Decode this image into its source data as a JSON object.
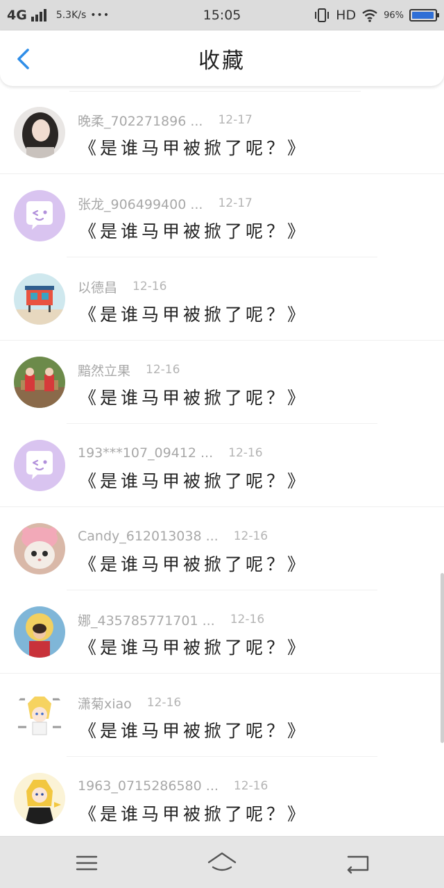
{
  "status_bar": {
    "network": "4G",
    "speed": "5.3K/s",
    "dots": "•••",
    "time": "15:05",
    "hd": "HD",
    "battery_text": "96%",
    "battery_level": 0.96
  },
  "header": {
    "title": "收藏",
    "back_icon": "chevron-left-icon",
    "accent_color": "#2f8ee8"
  },
  "items": [
    {
      "name": "晚柔_702271896 ...",
      "date": "12-17",
      "message": "《是谁马甲被掀了呢？》",
      "avatar": "photo-girl"
    },
    {
      "name": "张龙_906499400 ...",
      "date": "12-17",
      "message": "《是谁马甲被掀了呢？》",
      "avatar": "default-chat"
    },
    {
      "name": "以德昌",
      "date": "12-16",
      "message": "《是谁马甲被掀了呢？》",
      "avatar": "lifeguard-hut"
    },
    {
      "name": "黯然立果",
      "date": "12-16",
      "message": "《是谁马甲被掀了呢？》",
      "avatar": "two-people-bench"
    },
    {
      "name": "193***107_09412 ...",
      "date": "12-16",
      "message": "《是谁马甲被掀了呢？》",
      "avatar": "default-chat"
    },
    {
      "name": "Candy_612013038 ...",
      "date": "12-16",
      "message": "《是谁马甲被掀了呢？》",
      "avatar": "cat-pink-hat"
    },
    {
      "name": "娜_435785771701 ...",
      "date": "12-16",
      "message": "《是谁马甲被掀了呢？》",
      "avatar": "child-sun"
    },
    {
      "name": "潇菊xiao",
      "date": "12-16",
      "message": "《是谁马甲被掀了呢？》",
      "avatar": "anime-text"
    },
    {
      "name": "1963_0715286580 ...",
      "date": "12-16",
      "message": "《是谁马甲被掀了呢？》",
      "avatar": "anime-girl"
    }
  ],
  "nav_bar": {
    "menu_icon": "menu-icon",
    "home_icon": "home-icon",
    "back_icon": "back-arrow-icon"
  }
}
